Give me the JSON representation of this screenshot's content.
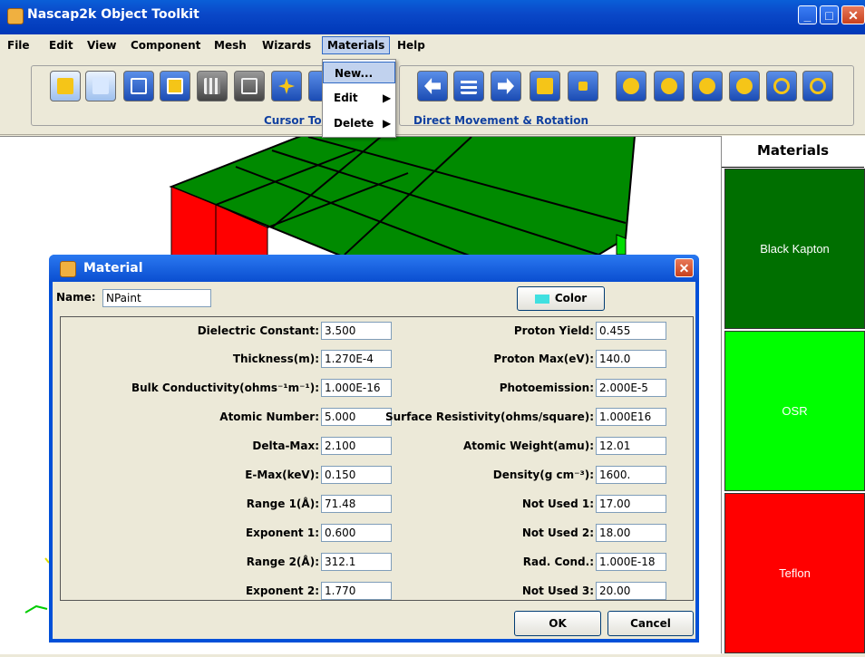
{
  "window": {
    "title": "Nascap2k Object Toolkit"
  },
  "menubar": [
    {
      "label": "File"
    },
    {
      "label": "Edit"
    },
    {
      "label": "View"
    },
    {
      "label": "Component"
    },
    {
      "label": "Mesh"
    },
    {
      "label": "Wizards"
    },
    {
      "label": "Materials"
    },
    {
      "label": "Help"
    }
  ],
  "materials_menu": {
    "items": [
      {
        "label": "New..."
      },
      {
        "label": "Edit"
      },
      {
        "label": "Delete"
      }
    ]
  },
  "toolbar": {
    "group1_label": "Cursor Tool",
    "group2_label": "Direct Movement & Rotation"
  },
  "materials_panel": {
    "header": "Materials",
    "items": [
      {
        "name": "Black Kapton",
        "color": "#006f00"
      },
      {
        "name": "OSR",
        "color": "#00ff00"
      },
      {
        "name": "Teflon",
        "color": "#ff0000"
      }
    ]
  },
  "dialog": {
    "title": "Material",
    "name_label": "Name:",
    "name_value": "NPaint",
    "color_button": "Color",
    "color_swatch": "#40e0e0",
    "left_fields": [
      {
        "label": "Dielectric Constant:",
        "value": "3.500"
      },
      {
        "label": "Thickness(m):",
        "value": "1.270E-4"
      },
      {
        "label": "Bulk Conductivity(ohms⁻¹m⁻¹):",
        "value": "1.000E-16"
      },
      {
        "label": "Atomic Number:",
        "value": "5.000"
      },
      {
        "label": "Delta-Max:",
        "value": "2.100"
      },
      {
        "label": "E-Max(keV):",
        "value": "0.150"
      },
      {
        "label": "Range 1(Å):",
        "value": "71.48"
      },
      {
        "label": "Exponent 1:",
        "value": "0.600"
      },
      {
        "label": "Range 2(Å):",
        "value": "312.1"
      },
      {
        "label": "Exponent 2:",
        "value": "1.770"
      }
    ],
    "right_fields": [
      {
        "label": "Proton Yield:",
        "value": "0.455"
      },
      {
        "label": "Proton Max(eV):",
        "value": "140.0"
      },
      {
        "label": "Photoemission:",
        "value": "2.000E-5"
      },
      {
        "label": "Surface Resistivity(ohms/square):",
        "value": "1.000E16"
      },
      {
        "label": "Atomic Weight(amu):",
        "value": "12.01"
      },
      {
        "label": "Density(g cm⁻³):",
        "value": "1600."
      },
      {
        "label": "Not Used 1:",
        "value": "17.00"
      },
      {
        "label": "Not Used 2:",
        "value": "18.00"
      },
      {
        "label": "Rad. Cond.:",
        "value": "1.000E-18"
      },
      {
        "label": "Not Used 3:",
        "value": "20.00"
      }
    ],
    "ok_label": "OK",
    "cancel_label": "Cancel"
  }
}
